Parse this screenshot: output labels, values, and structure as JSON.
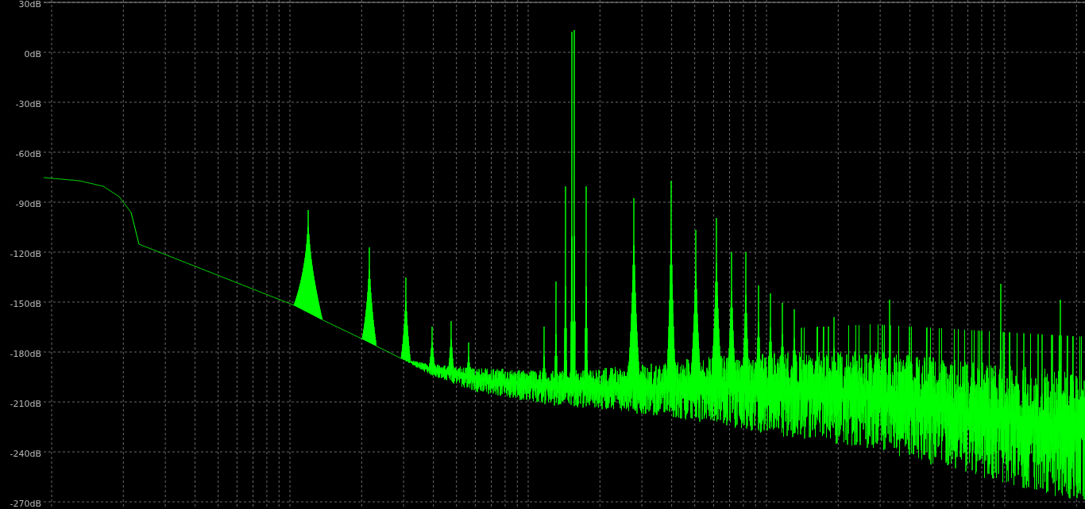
{
  "y_axis": {
    "ticks": [
      "30dB",
      "0dB",
      "-30dB",
      "-60dB",
      "-90dB",
      "-120dB",
      "-150dB",
      "-180dB",
      "-210dB",
      "-240dB",
      "-270dB"
    ]
  }
}
